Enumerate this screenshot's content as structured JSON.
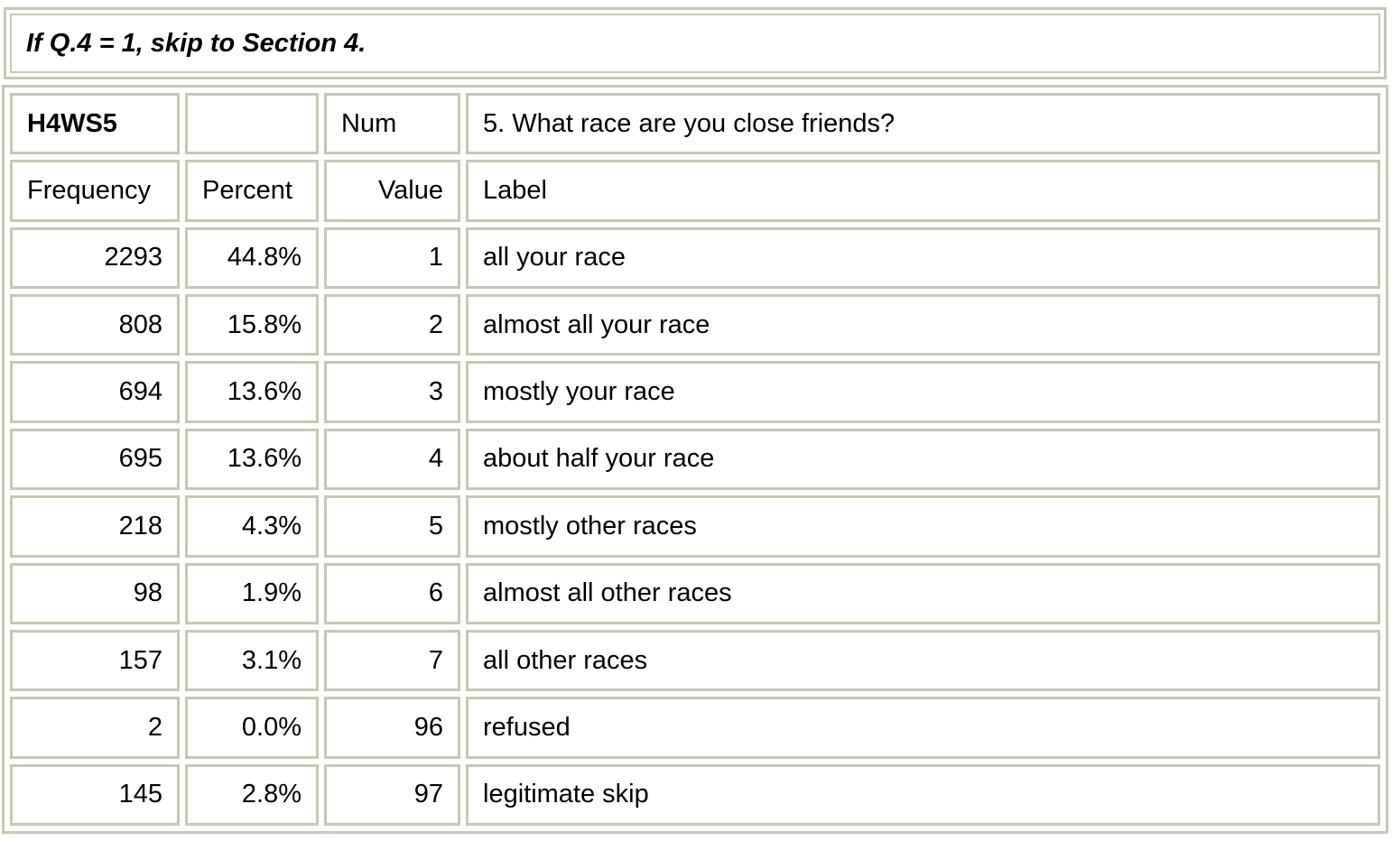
{
  "note": "If Q.4 = 1, skip to Section 4.",
  "variable": {
    "name": "H4WS5",
    "blank": "",
    "type": "Num",
    "question": "5. What race are you close friends?"
  },
  "headers": {
    "frequency": "Frequency",
    "percent": "Percent",
    "value": "Value",
    "label": "Label"
  },
  "rows": [
    {
      "frequency": "2293",
      "percent": "44.8%",
      "value": "1",
      "label": "all your race"
    },
    {
      "frequency": "808",
      "percent": "15.8%",
      "value": "2",
      "label": "almost all your race"
    },
    {
      "frequency": "694",
      "percent": "13.6%",
      "value": "3",
      "label": "mostly your race"
    },
    {
      "frequency": "695",
      "percent": "13.6%",
      "value": "4",
      "label": "about half your race"
    },
    {
      "frequency": "218",
      "percent": "4.3%",
      "value": "5",
      "label": "mostly other races"
    },
    {
      "frequency": "98",
      "percent": "1.9%",
      "value": "6",
      "label": "almost all other races"
    },
    {
      "frequency": "157",
      "percent": "3.1%",
      "value": "7",
      "label": "all other races"
    },
    {
      "frequency": "2",
      "percent": "0.0%",
      "value": "96",
      "label": "refused"
    },
    {
      "frequency": "145",
      "percent": "2.8%",
      "value": "97",
      "label": "legitimate skip"
    }
  ],
  "colors": {
    "border": "#c9c6b4",
    "background": "#ffffff",
    "text": "#000000"
  }
}
